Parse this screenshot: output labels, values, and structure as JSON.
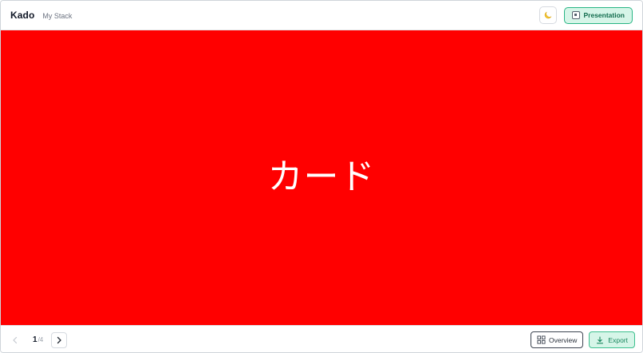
{
  "header": {
    "app_name": "Kado",
    "stack_name": "My Stack",
    "theme_toggle_icon": "moon-icon",
    "presentation_label": "Presentation",
    "presentation_icon": "presentation-icon"
  },
  "card": {
    "text": "カード",
    "background_color": "#ff0000",
    "text_color": "#ffffff"
  },
  "footer": {
    "pagination": {
      "current": "1",
      "separator": "/",
      "total": "4"
    },
    "overview_label": "Overview",
    "export_label": "Export"
  },
  "colors": {
    "accent": "#27b584",
    "accent_bg": "#d6f5e8"
  }
}
